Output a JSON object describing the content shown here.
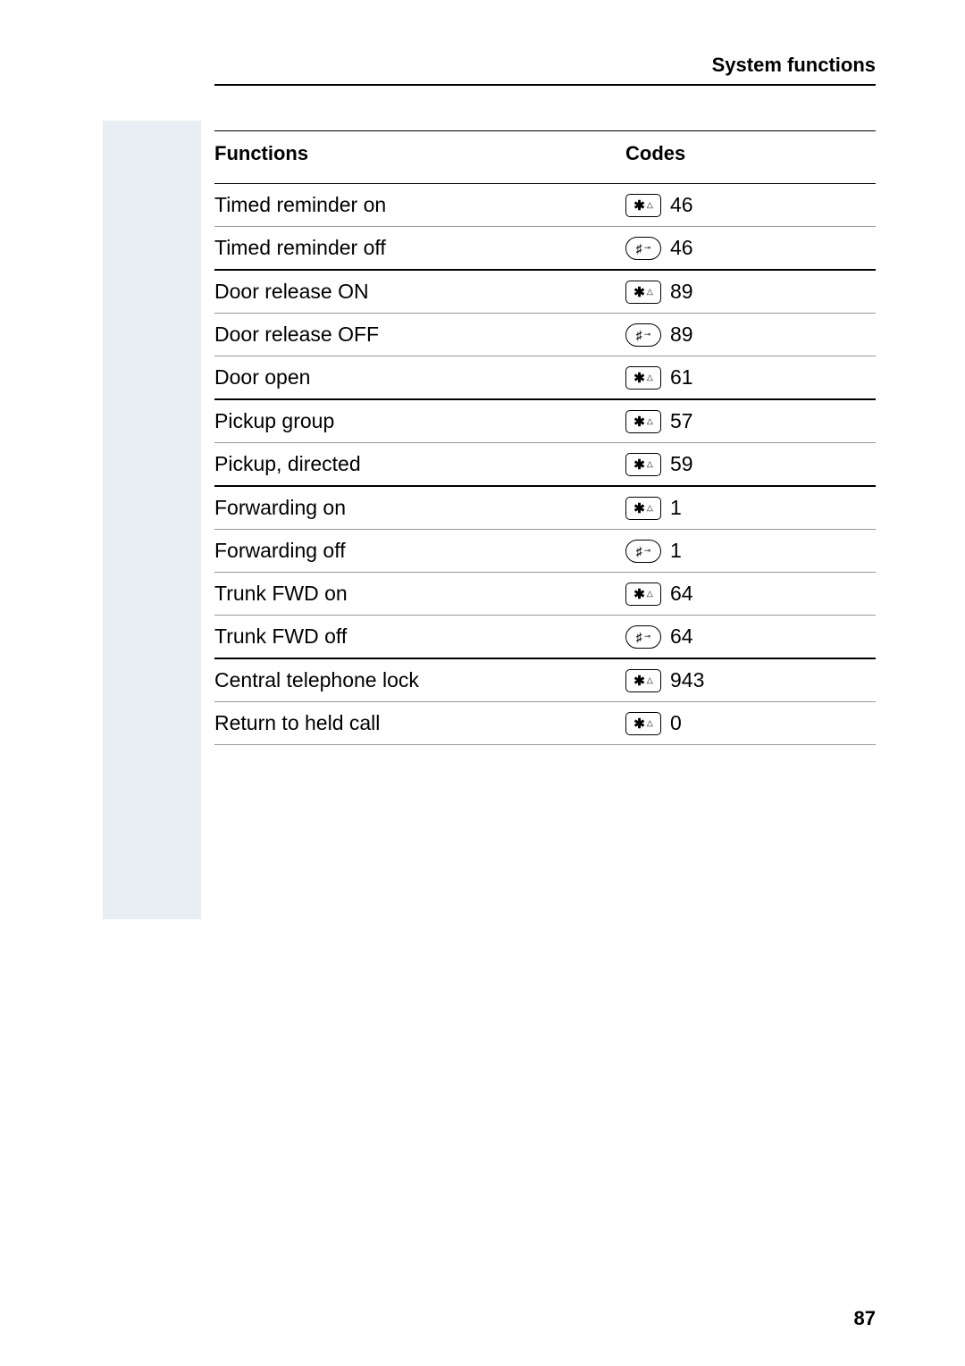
{
  "header": {
    "title": "System functions"
  },
  "table": {
    "functions_header": "Functions",
    "codes_header": "Codes"
  },
  "rows": [
    {
      "function": "Timed reminder on",
      "key": "star",
      "code": "46",
      "divider": false
    },
    {
      "function": "Timed reminder off",
      "key": "hash",
      "code": "46",
      "divider": true
    },
    {
      "function": "Door release ON",
      "key": "star",
      "code": "89",
      "divider": false
    },
    {
      "function": "Door release OFF",
      "key": "hash",
      "code": "89",
      "divider": false
    },
    {
      "function": "Door open",
      "key": "star",
      "code": "61",
      "divider": true
    },
    {
      "function": "Pickup group",
      "key": "star",
      "code": "57",
      "divider": false
    },
    {
      "function": "Pickup, directed",
      "key": "star",
      "code": "59",
      "divider": true
    },
    {
      "function": "Forwarding on",
      "key": "star",
      "code": "1",
      "divider": false
    },
    {
      "function": "Forwarding off",
      "key": "hash",
      "code": "1",
      "divider": false
    },
    {
      "function": "Trunk FWD on",
      "key": "star",
      "code": "64",
      "divider": false
    },
    {
      "function": "Trunk FWD off",
      "key": "hash",
      "code": "64",
      "divider": true
    },
    {
      "function": "Central telephone lock",
      "key": "star",
      "code": "943",
      "divider": false
    },
    {
      "function": "Return to held call",
      "key": "star",
      "code": "0",
      "divider": false
    }
  ],
  "page_number": "87"
}
